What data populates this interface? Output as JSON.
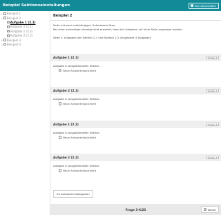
{
  "header": {
    "title": "Beispiel Sektionseinstellungen",
    "finish_label": "Test abschließen",
    "finish_icon": "check-circle-icon",
    "accent_color": "#138a98"
  },
  "sidebar": {
    "items": [
      {
        "label": "Beispiel 1",
        "toggle": "+",
        "checked": false,
        "active": false
      },
      {
        "label": "Beispiel 2",
        "toggle": "−",
        "checked": false,
        "active": false
      },
      {
        "label": "Aufgabe 1 (2.1)",
        "toggle": "",
        "checked": true,
        "active": true
      },
      {
        "label": "Aufgabe 2 (2.1)",
        "toggle": "",
        "checked": true,
        "active": false
      },
      {
        "label": "Aufgabe 1 (2.2)",
        "toggle": "",
        "checked": true,
        "active": false
      },
      {
        "label": "Aufgabe 2 (2.2)",
        "toggle": "",
        "checked": true,
        "active": false
      },
      {
        "label": "Beispiel 3",
        "toggle": "+",
        "checked": false,
        "active": false
      },
      {
        "label": "Beispiel 4",
        "toggle": "+",
        "checked": false,
        "active": false
      }
    ]
  },
  "main": {
    "title": "Beispiel 2",
    "intro_lines": [
      "Seite mit zwei unabhängigen Unterabschnitten.",
      "Bei einer erstmaligen Anzeige wird erwartet, dass alle Aufgaben auf einer Seite angezeigt werden.",
      "Seite 1: Aufgaben der Sektion 2.1 und Sektion 2.2 (insgesamt 4 Aufgaben)"
    ],
    "questions": [
      {
        "title": "Aufgabe 1 (2.1)",
        "badge": "Punkte: 1",
        "text": "Aufgabe in ausgeblendeter Sektion",
        "option": "Neue Antwortmöglichkeit"
      },
      {
        "title": "Aufgabe 2 (2.1)",
        "badge": "Punkte: 1",
        "text": "Aufgabe in ausgeblendeter Sektion",
        "option": "Neue Antwortmöglichkeit"
      },
      {
        "title": "Aufgabe 1 (2.2)",
        "badge": "Punkte: 1",
        "text": "Aufgabe in ausgeblendeter Sektion",
        "option": "Neue Antwortmöglichkeit"
      },
      {
        "title": "Aufgabe 2 (2.2)",
        "badge": "Punkte: 1",
        "text": "Aufgabe in ausgeblendeter Sektion",
        "option": "Neue Antwortmöglichkeit"
      }
    ],
    "summary_label": "Zu Antworten übergehen"
  },
  "footer": {
    "progress": "Frage 3-6/23",
    "next_label": "Weiter",
    "next_icon": "arrow-right-circle-icon"
  }
}
